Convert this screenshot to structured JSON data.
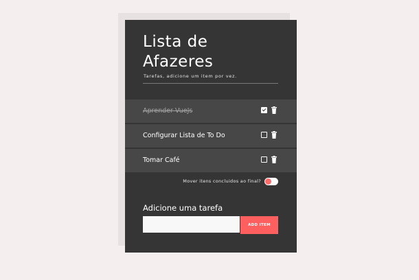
{
  "header": {
    "title": "Lista de Afazeres",
    "subtitle": "Tarefas, adicione um item por vez."
  },
  "todos": [
    {
      "label": "Aprender VueJs",
      "done": true
    },
    {
      "label": "Configurar Lista de To Do",
      "done": false
    },
    {
      "label": "Tomar Café",
      "done": false
    }
  ],
  "options": {
    "move_completed_label": "Mover itens concluidos ao final?",
    "move_completed_on": false
  },
  "add": {
    "label": "Adicione uma tarefa",
    "input_value": "",
    "button_label": "ADD ITEM"
  },
  "colors": {
    "background": "#f5eeee",
    "card": "#353535",
    "row": "#474747",
    "accent": "#ff5f5f"
  },
  "icons": {
    "checkbox": "checkbox-icon",
    "trash": "trash-icon"
  }
}
